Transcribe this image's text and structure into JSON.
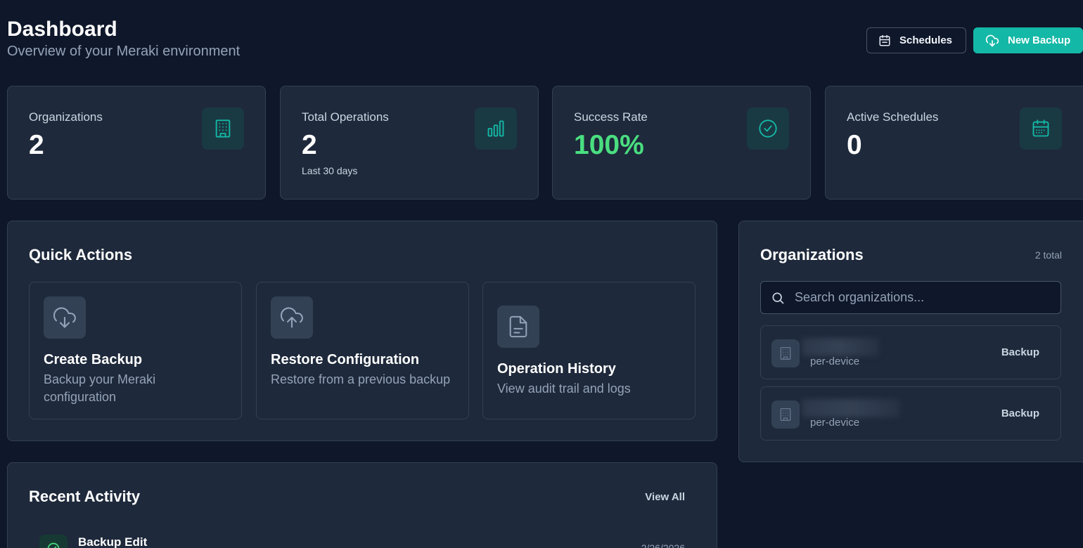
{
  "header": {
    "title": "Dashboard",
    "subtitle": "Overview of your Meraki environment",
    "schedules_label": "Schedules",
    "new_backup_label": "New Backup"
  },
  "stats": [
    {
      "label": "Organizations",
      "value": "2",
      "sub": "",
      "icon": "building-icon"
    },
    {
      "label": "Total Operations",
      "value": "2",
      "sub": "Last 30 days",
      "icon": "bar-chart-icon"
    },
    {
      "label": "Success Rate",
      "value": "100%",
      "sub": "",
      "icon": "check-circle-icon"
    },
    {
      "label": "Active Schedules",
      "value": "0",
      "sub": "",
      "icon": "calendar-icon"
    }
  ],
  "quick_actions": {
    "title": "Quick Actions",
    "items": [
      {
        "title": "Create Backup",
        "desc": "Backup your Meraki configuration",
        "icon": "cloud-download-icon"
      },
      {
        "title": "Restore Configuration",
        "desc": "Restore from a previous backup",
        "icon": "cloud-upload-icon"
      },
      {
        "title": "Operation History",
        "desc": "View audit trail and logs",
        "icon": "file-icon"
      }
    ]
  },
  "organizations": {
    "title": "Organizations",
    "count_label": "2 total",
    "search_placeholder": "Search organizations...",
    "items": [
      {
        "type": "per-device",
        "action": "Backup"
      },
      {
        "type": "per-device",
        "action": "Backup"
      }
    ]
  },
  "recent_activity": {
    "title": "Recent Activity",
    "view_all_label": "View All",
    "items": [
      {
        "title": "Backup Edit",
        "date": "2/26/2026"
      }
    ]
  },
  "colors": {
    "background": "#0f172a",
    "card": "#1e293b",
    "accent": "#14b8a6",
    "success": "#4ade80"
  }
}
